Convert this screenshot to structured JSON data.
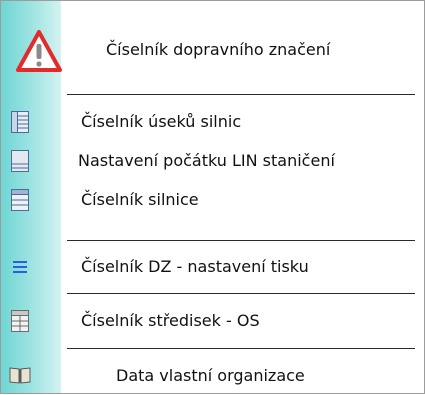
{
  "menu": {
    "items": [
      {
        "label": "Číselník dopravního značení",
        "icon": "warning-triangle-icon"
      },
      {
        "label": "Číselník úseků silnic",
        "icon": "road-sections-icon"
      },
      {
        "label": "Nastavení počátku LIN staničení",
        "icon": "lin-origin-icon"
      },
      {
        "label": "Číselník silnice",
        "icon": "roads-icon"
      },
      {
        "label": "Číselník DZ - nastavení tisku",
        "icon": "list-lines-icon"
      },
      {
        "label": "Číselník středisek - OS",
        "icon": "table-icon"
      },
      {
        "label": "Data vlastní organizace",
        "icon": "book-icon"
      }
    ]
  },
  "colors": {
    "strip": "#8ee0de",
    "warning": "#e22b2b",
    "list_blue": "#2e5fd8"
  }
}
